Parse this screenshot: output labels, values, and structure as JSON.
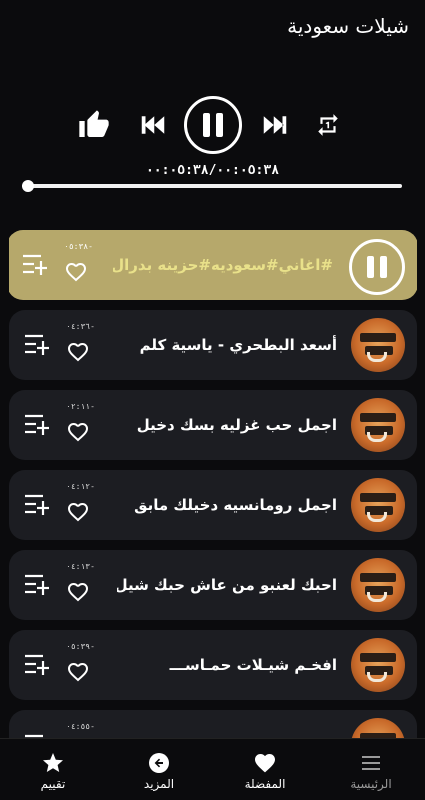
{
  "app": {
    "title": "شيلات سعودية"
  },
  "player": {
    "time_readout": "٠٠:٠٥:٣٨/٠٠:٠٥:٣٨",
    "progress": 0.0
  },
  "tracks": [
    {
      "title": "#اغاني#سعوديه#حزينه بدرال",
      "duration": "٠٥:٣٨-",
      "active": true
    },
    {
      "title": "أسعد البطحري - ياسية كلم",
      "duration": "٠٤:٣٦-",
      "active": false
    },
    {
      "title": "اجمل حب غزليه  بسك دخيل",
      "duration": "٠٢:١١-",
      "active": false
    },
    {
      "title": "اجمل رومانسيه دخيلك مابق",
      "duration": "٠٤:١٢-",
      "active": false
    },
    {
      "title": "احبك لعنبو من عاش حبك شيل",
      "duration": "٠٤:١٣-",
      "active": false
    },
    {
      "title": "افخـم شيـلات حمـاســـ",
      "duration": "٠٥:٣٩-",
      "active": false
    },
    {
      "title": "",
      "duration": "٠٤:٥٥-",
      "active": false
    }
  ],
  "bottom_nav": {
    "rate": "تقييم",
    "more": "المزيد",
    "favorites": "المفضلة",
    "home": "الرئيسية"
  },
  "colors": {
    "active_track": "#b6a86b",
    "active_title": "#e9e18a",
    "card": "#1c1d22",
    "background": "#0b0b0d"
  }
}
